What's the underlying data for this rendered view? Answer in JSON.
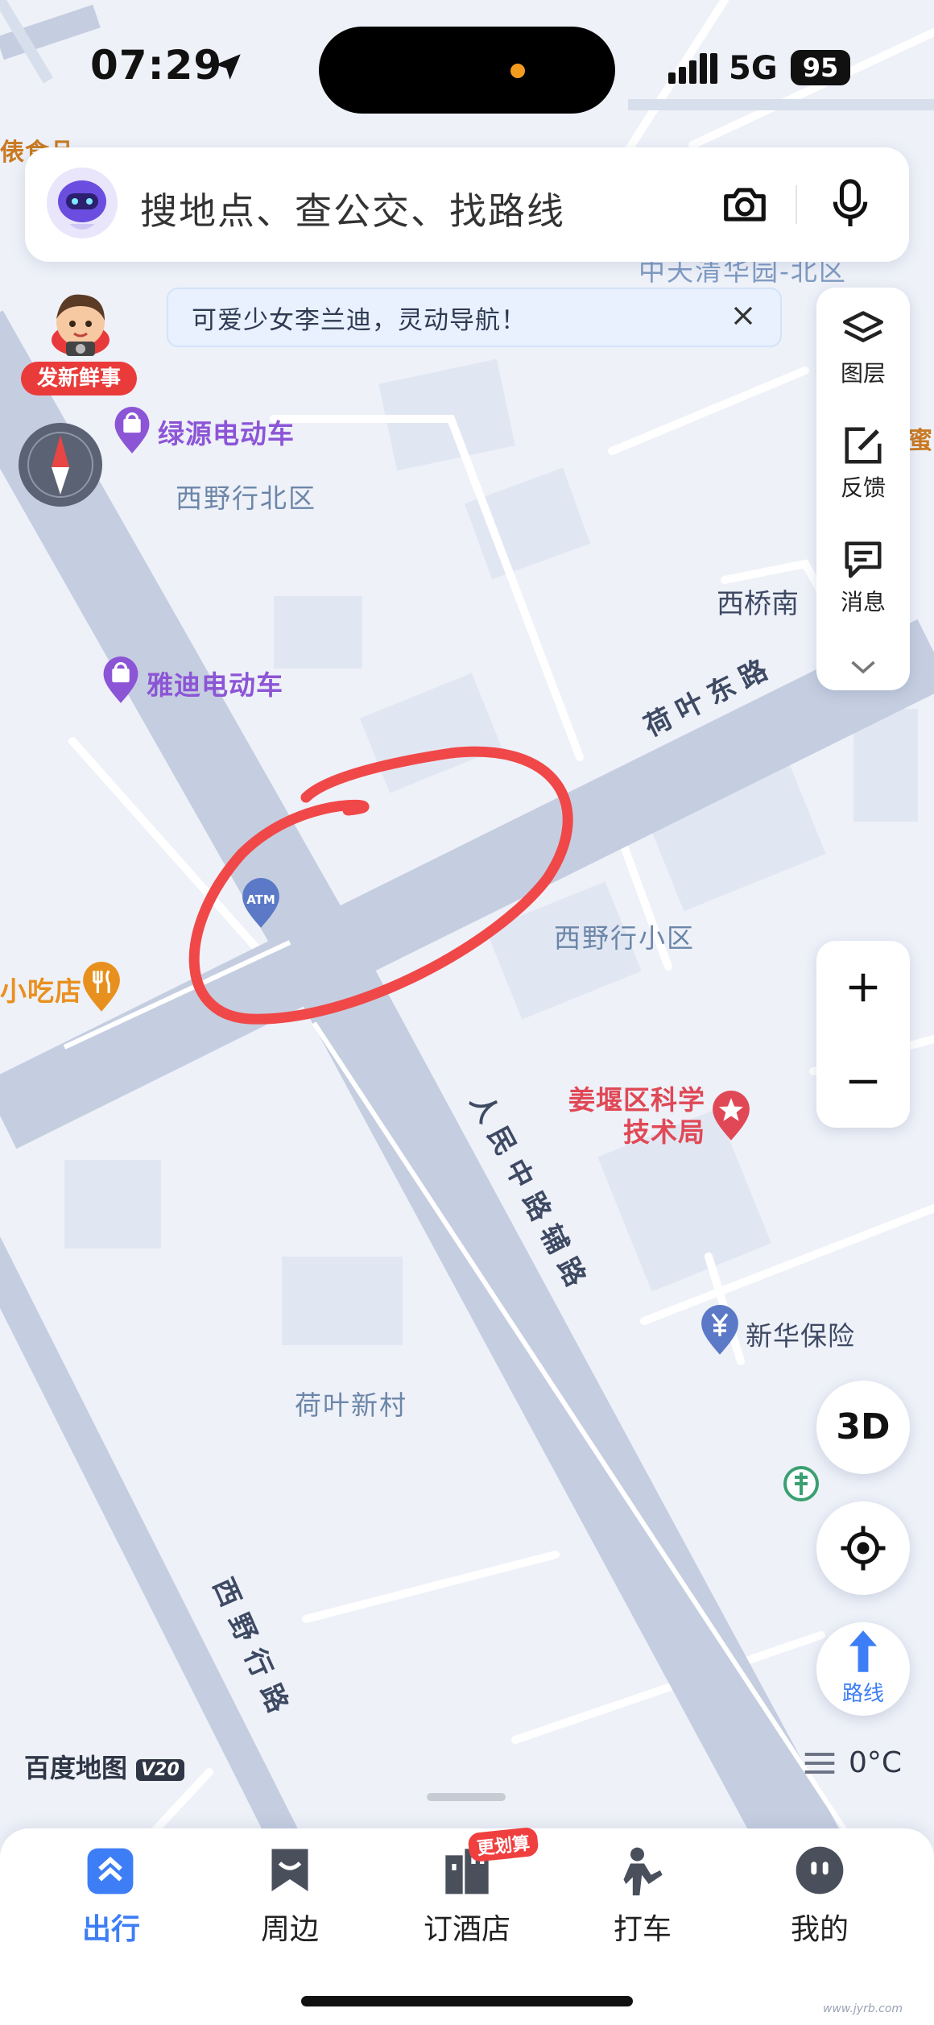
{
  "status_bar": {
    "time": "07:29",
    "network": "5G",
    "battery": "95"
  },
  "search": {
    "placeholder": "搜地点、查公交、找路线"
  },
  "notice": {
    "text": "可爱少女李兰迪，灵动导航！"
  },
  "promo": {
    "label": "发新鲜事"
  },
  "side_panel": {
    "layers": "图层",
    "feedback": "反馈",
    "messages": "消息"
  },
  "map_labels": {
    "poi_top_left": "俵食品",
    "area_top": "中天清华园-北区",
    "poi_right_edge": "蜜雪",
    "ebike_1": "绿源电动车",
    "area_1": "西野行北区",
    "place_xiqiaonan": "西桥南",
    "ebike_2": "雅迪电动车",
    "road_heye_east": "荷叶东路",
    "atm": "ATM",
    "area_2": "西野行小区",
    "snack": "小吃店",
    "gov_name_1": "姜堰区科学",
    "gov_name_2": "技术局",
    "road_renmin": "人民中路辅路",
    "insurance": "新华保险",
    "area_3": "荷叶新村",
    "road_xiye": "西野行路"
  },
  "controls": {
    "btn_3d": "3D",
    "route": "路线",
    "temperature": "0°C"
  },
  "brand": {
    "name": "百度地图",
    "version": "V20"
  },
  "tabs": [
    {
      "label": "出行",
      "active": true
    },
    {
      "label": "周边",
      "active": false
    },
    {
      "label": "订酒店",
      "active": false,
      "badge": "更划算"
    },
    {
      "label": "打车",
      "active": false
    },
    {
      "label": "我的",
      "active": false
    }
  ],
  "watermark": "www.jyrb.com",
  "colors": {
    "accent": "#3d7ef6",
    "annotation": "#f04848",
    "poi_purple": "#8c55d6",
    "poi_orange": "#e8901e",
    "gov_red": "#e04856"
  }
}
